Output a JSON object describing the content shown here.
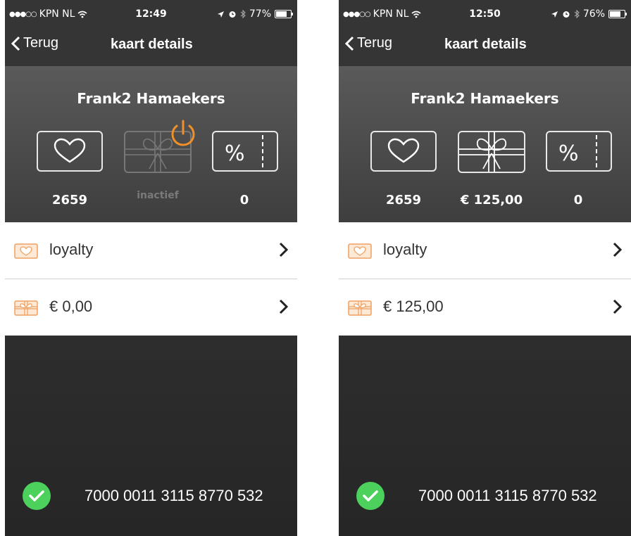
{
  "screens": [
    {
      "status": {
        "carrier": "KPN NL",
        "time": "12:49",
        "battery": "77%",
        "battery_level": 0.77
      },
      "nav": {
        "back_label": "Terug",
        "title": "kaart details"
      },
      "header": {
        "name": "Frank2  Hamaekers",
        "stats": {
          "loyalty_points": "2659",
          "gift_value": "inactief",
          "discounts": "0"
        },
        "gift_state": "inactive",
        "accent_color": "#f0902a"
      },
      "list": [
        {
          "icon": "loyalty-card-icon",
          "label": "loyalty"
        },
        {
          "icon": "gift-card-icon",
          "label": "€ 0,00"
        }
      ],
      "footer": {
        "card_number": "7000 0011 3115 8770 532",
        "status": "verified"
      }
    },
    {
      "status": {
        "carrier": "KPN NL",
        "time": "12:50",
        "battery": "76%",
        "battery_level": 0.76
      },
      "nav": {
        "back_label": "Terug",
        "title": "kaart details"
      },
      "header": {
        "name": "Frank2  Hamaekers",
        "stats": {
          "loyalty_points": "2659",
          "gift_value": "€ 125,00",
          "discounts": "0"
        },
        "gift_state": "active",
        "accent_color": "#f0902a"
      },
      "list": [
        {
          "icon": "loyalty-card-icon",
          "label": "loyalty"
        },
        {
          "icon": "gift-card-icon",
          "label": "€ 125,00"
        }
      ],
      "footer": {
        "card_number": "7000 0011 3115 8770 532",
        "status": "verified"
      }
    }
  ]
}
